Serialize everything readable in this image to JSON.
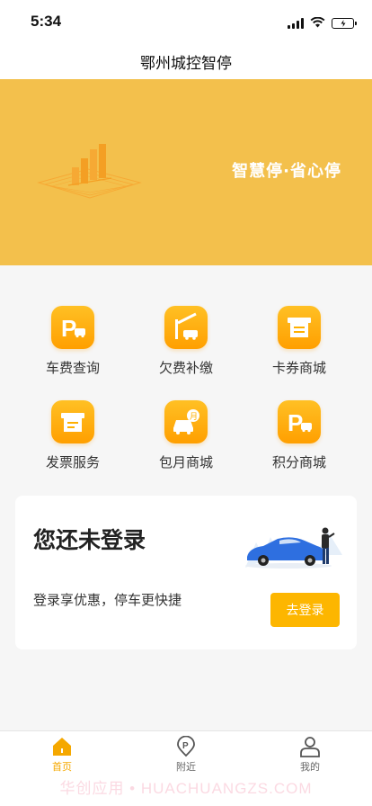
{
  "status_bar": {
    "time": "5:34"
  },
  "nav": {
    "title": "鄂州城控智停"
  },
  "banner": {
    "slogan": "智慧停·省心停"
  },
  "menu": [
    {
      "label": "车费查询",
      "icon": "parking-car-icon"
    },
    {
      "label": "欠费补缴",
      "icon": "barrier-gate-icon"
    },
    {
      "label": "卡券商城",
      "icon": "coupon-shop-icon"
    },
    {
      "label": "发票服务",
      "icon": "invoice-icon"
    },
    {
      "label": "包月商城",
      "icon": "monthly-pass-icon"
    },
    {
      "label": "积分商城",
      "icon": "points-parking-icon"
    }
  ],
  "login_card": {
    "title": "您还未登录",
    "description": "登录享优惠，停车更快捷",
    "button": "去登录"
  },
  "tabs": [
    {
      "label": "首页",
      "icon": "home-icon",
      "active": true
    },
    {
      "label": "附近",
      "icon": "location-parking-icon",
      "active": false
    },
    {
      "label": "我的",
      "icon": "user-icon",
      "active": false
    }
  ],
  "watermark": "华创应用 • HUACHUANGZS.COM",
  "colors": {
    "accent": "#fdb600",
    "banner": "#f3c04c",
    "tab_active": "#f5a800"
  }
}
